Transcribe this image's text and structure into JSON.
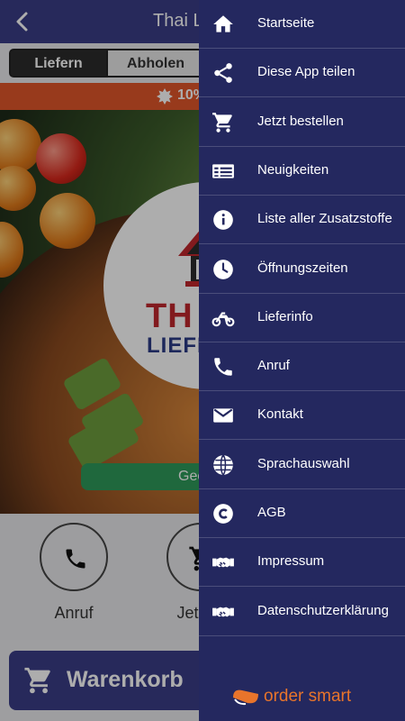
{
  "header": {
    "title": "Thai Li"
  },
  "tabs": {
    "deliver": "Liefern",
    "pickup": "Abholen"
  },
  "promo": {
    "text": "10%"
  },
  "hero": {
    "logo_line1": "TH",
    "logo_line2": "LIEFE",
    "open_button": "Geö"
  },
  "actions": {
    "call_label": "Anruf",
    "order_label": "Jetzt b"
  },
  "cart": {
    "label": "Warenkorb"
  },
  "drawer": {
    "items": [
      {
        "label": "Startseite",
        "icon": "home-icon"
      },
      {
        "label": "Diese App teilen",
        "icon": "share-icon"
      },
      {
        "label": "Jetzt bestellen",
        "icon": "cart-icon"
      },
      {
        "label": "Neuigkeiten",
        "icon": "news-icon"
      },
      {
        "label": "Liste aller Zusatzstoffe",
        "icon": "info-icon"
      },
      {
        "label": "Öffnungszeiten",
        "icon": "clock-icon"
      },
      {
        "label": "Lieferinfo",
        "icon": "motorbike-icon"
      },
      {
        "label": "Anruf",
        "icon": "phone-icon"
      },
      {
        "label": "Kontakt",
        "icon": "mail-icon"
      },
      {
        "label": "Sprachauswahl",
        "icon": "globe-icon"
      },
      {
        "label": "AGB",
        "icon": "copyright-icon"
      },
      {
        "label": "Impressum",
        "icon": "handshake-icon"
      },
      {
        "label": "Datenschutzerklärung",
        "icon": "handshake-icon"
      }
    ],
    "brand": "order smart"
  },
  "colors": {
    "header": "#3a3d86",
    "drawer": "#24285f",
    "promo": "#e1562a",
    "open_button": "#2e9a5a",
    "brand": "#e8742b"
  }
}
